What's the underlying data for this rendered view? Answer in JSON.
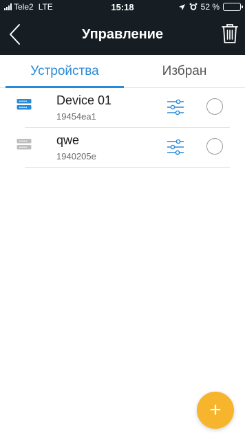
{
  "status_bar": {
    "carrier": "Tele2",
    "network": "LTE",
    "time": "15:18",
    "battery_text": "52 %",
    "battery_level": 0.52
  },
  "nav": {
    "title": "Управление",
    "back_icon": "chevron-left-icon",
    "delete_icon": "trash-icon"
  },
  "tabs": [
    {
      "label": "Устройства",
      "active": true
    },
    {
      "label": "Избран",
      "active": false
    }
  ],
  "devices": [
    {
      "name": "Device 01",
      "id": "19454ea1",
      "icon": "router-icon",
      "online": true
    },
    {
      "name": "qwe",
      "id": "1940205e",
      "icon": "router-icon",
      "online": false
    }
  ],
  "fab": {
    "label": "+"
  },
  "colors": {
    "header_bg": "#161e24",
    "accent": "#2b8ad8",
    "fab": "#f7b52d",
    "device_online": "#2b8ad8",
    "device_offline": "#bdbdbd"
  }
}
